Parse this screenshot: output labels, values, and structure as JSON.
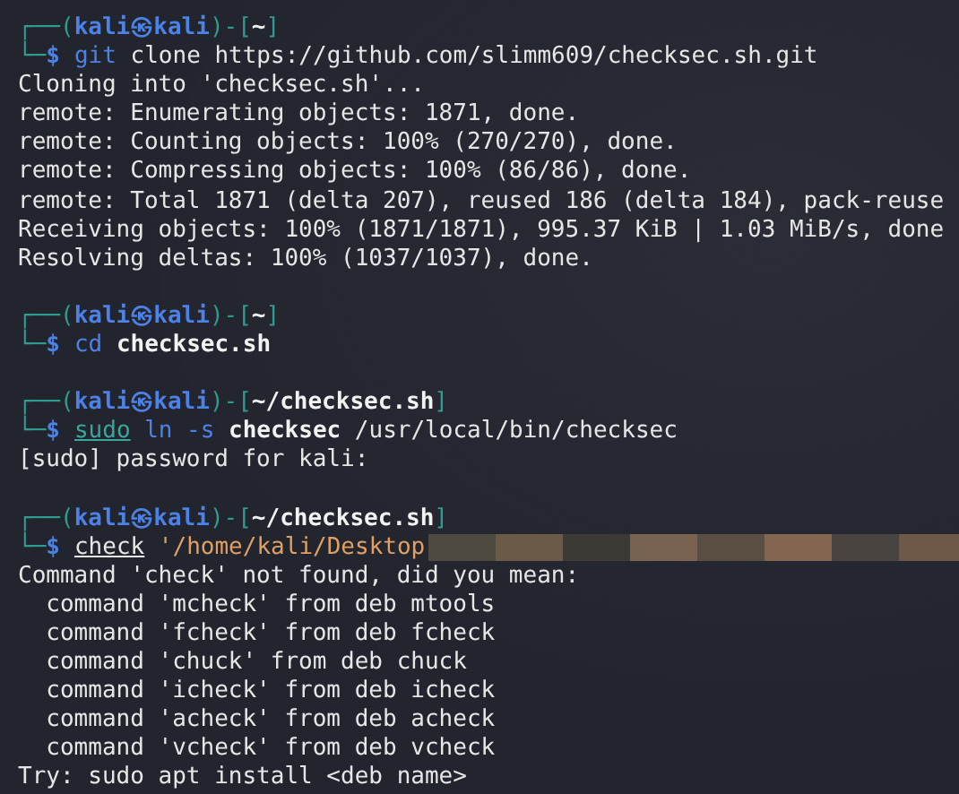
{
  "terminal": {
    "lines": [
      {
        "kind": "prompt",
        "top": "┌──(",
        "user": "kali",
        "at": "㉿",
        "host": "kali",
        "sep": ")-[",
        "path": "~",
        "close": "]",
        "corner": "└─",
        "symbol": "$",
        "tokens": [
          {
            "kind": "command",
            "text": "git"
          },
          {
            "kind": "argument",
            "text": "clone"
          },
          {
            "kind": "argument",
            "text": "https://github.com/slimm609/checksec.sh.git"
          }
        ]
      },
      {
        "kind": "output",
        "text": "Cloning into 'checksec.sh'..."
      },
      {
        "kind": "output",
        "text": "remote: Enumerating objects: 1871, done."
      },
      {
        "kind": "output",
        "text": "remote: Counting objects: 100% (270/270), done."
      },
      {
        "kind": "output",
        "text": "remote: Compressing objects: 100% (86/86), done."
      },
      {
        "kind": "output",
        "text": "remote: Total 1871 (delta 207), reused 186 (delta 184), pack-reuse"
      },
      {
        "kind": "output",
        "text": "Receiving objects: 100% (1871/1871), 995.37 KiB | 1.03 MiB/s, done"
      },
      {
        "kind": "output",
        "text": "Resolving deltas: 100% (1037/1037), done."
      },
      {
        "kind": "blank"
      },
      {
        "kind": "prompt",
        "top": "┌──(",
        "user": "kali",
        "at": "㉿",
        "host": "kali",
        "sep": ")-[",
        "path": "~",
        "close": "]",
        "corner": "└─",
        "symbol": "$",
        "tokens": [
          {
            "kind": "command",
            "text": "cd"
          },
          {
            "kind": "path",
            "text": "checksec.sh"
          }
        ]
      },
      {
        "kind": "blank"
      },
      {
        "kind": "prompt",
        "top": "┌──(",
        "user": "kali",
        "at": "㉿",
        "host": "kali",
        "sep": ")-[",
        "path": "~/checksec.sh",
        "close": "]",
        "corner": "└─",
        "symbol": "$",
        "tokens": [
          {
            "kind": "sudo",
            "text": "sudo"
          },
          {
            "kind": "command",
            "text": "ln"
          },
          {
            "kind": "option",
            "text": "-s"
          },
          {
            "kind": "path",
            "text": "checksec"
          },
          {
            "kind": "argument",
            "text": "/usr/local/bin/checksec"
          }
        ]
      },
      {
        "kind": "output",
        "text": "[sudo] password for kali:"
      },
      {
        "kind": "blank"
      },
      {
        "kind": "prompt",
        "top": "┌──(",
        "user": "kali",
        "at": "㉿",
        "host": "kali",
        "sep": ")-[",
        "path": "~/checksec.sh",
        "close": "]",
        "corner": "└─",
        "symbol": "$",
        "redacted": true,
        "tokens": [
          {
            "kind": "unknown",
            "text": "check"
          },
          {
            "kind": "string",
            "text": "'/home/kali/Desktop"
          }
        ]
      },
      {
        "kind": "output",
        "text": "Command 'check' not found, did you mean:"
      },
      {
        "kind": "output",
        "text": "  command 'mcheck' from deb mtools"
      },
      {
        "kind": "output",
        "text": "  command 'fcheck' from deb fcheck"
      },
      {
        "kind": "output",
        "text": "  command 'chuck' from deb chuck"
      },
      {
        "kind": "output",
        "text": "  command 'icheck' from deb icheck"
      },
      {
        "kind": "output",
        "text": "  command 'acheck' from deb acheck"
      },
      {
        "kind": "output",
        "text": "  command 'vcheck' from deb vcheck"
      },
      {
        "kind": "output",
        "text": "Try: sudo apt install <deb name>"
      }
    ]
  }
}
